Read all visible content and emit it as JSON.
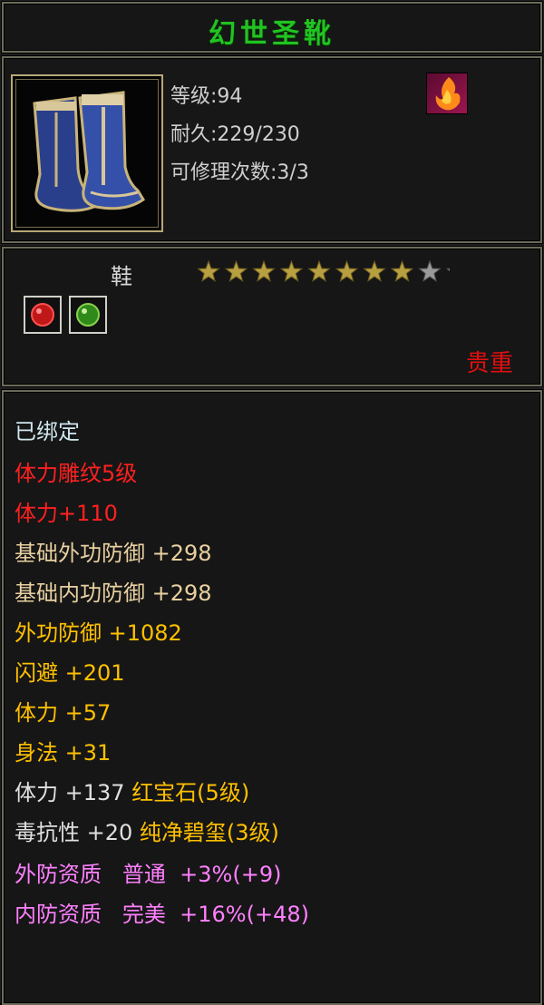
{
  "item": {
    "name": "幻世圣靴",
    "level_text": "等级:94",
    "durability_text": "耐久:229/230",
    "repair_text": "可修理次数:3/3",
    "type": "鞋",
    "stars_total": 10,
    "stars_filled": 8,
    "rarity": "贵重",
    "gems": [
      {
        "name": "red-gem-icon",
        "color": "#d01818"
      },
      {
        "name": "green-gem-icon",
        "color": "#3aa020"
      }
    ]
  },
  "colors": {
    "title": "#22c322",
    "bound": "#cfe6ee",
    "red": "#ff2020",
    "base": "#e8d0a0",
    "gold": "#ffc000",
    "white": "#e0e0e0",
    "pink": "#ff80ff",
    "star_filled": "#b8a040",
    "star_empty": "#9a9a9a"
  },
  "attributes": {
    "bound": "已绑定",
    "engrave": "体力雕纹5级",
    "vit_bonus": "体力+110",
    "base_out_def": "基础外功防御 +298",
    "base_in_def": "基础内功防御 +298",
    "out_def": "外功防御 +1082",
    "dodge": "闪避 +201",
    "vit": "体力 +57",
    "agility": "身法 +31",
    "gem1_stat": "体力 +137 ",
    "gem1_name": "红宝石(5级)",
    "gem2_stat": "毒抗性 +20 ",
    "gem2_name": "纯净碧玺(3级)",
    "q1_label": "外防资质",
    "q1_grade": "普通",
    "q1_value": "+3%(+9)",
    "q2_label": "内防资质",
    "q2_grade": "完美",
    "q2_value": "+16%(+48)"
  }
}
